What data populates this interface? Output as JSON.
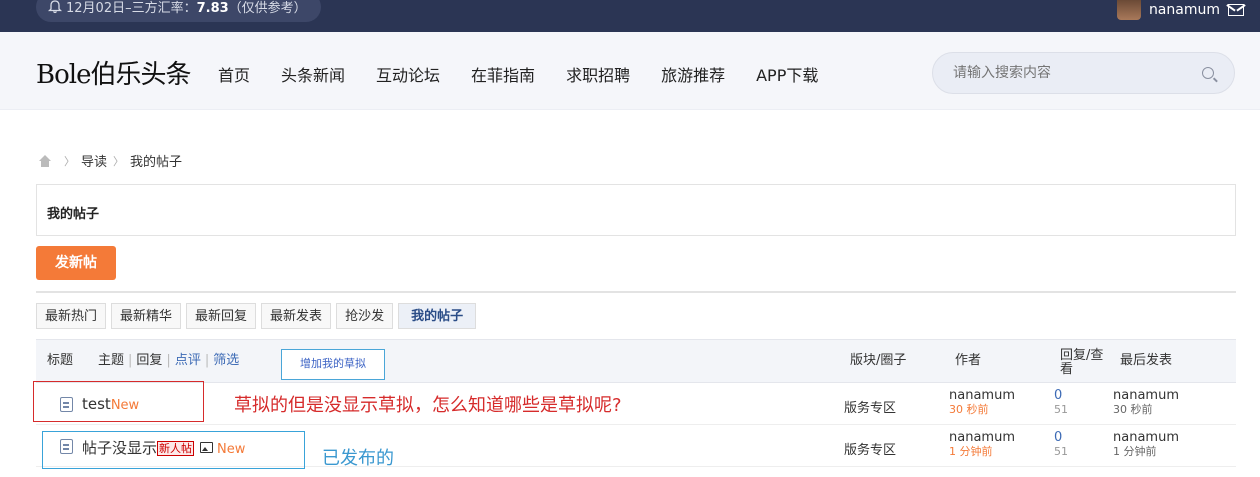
{
  "topbar": {
    "notice_prefix": "12月02日–三方汇率：",
    "notice_rate": "7.83",
    "notice_suffix": "（仅供参考）",
    "username": "nanamum"
  },
  "header": {
    "logo": "Bole伯乐头条",
    "nav": [
      "首页",
      "头条新闻",
      "互动论坛",
      "在菲指南",
      "求职招聘",
      "旅游推荐",
      "APP下载"
    ],
    "search_placeholder": "请输入搜索内容"
  },
  "breadcrumb": {
    "items": [
      "导读",
      "我的帖子"
    ]
  },
  "section": {
    "title": "我的帖子",
    "new_post": "发新帖"
  },
  "tabs": [
    "最新热门",
    "最新精华",
    "最新回复",
    "最新发表",
    "抢沙发",
    "我的帖子"
  ],
  "table_header": {
    "title": "标题",
    "filter_subject": "主题",
    "filter_reply": "回复",
    "filter_review": "点评",
    "filter_filter": "筛选",
    "add_draft": "增加我的草拟",
    "forum": "版块/圈子",
    "author": "作者",
    "replies_views": "回复/查看",
    "last_post": "最后发表"
  },
  "rows": [
    {
      "title": "test",
      "tag": "New",
      "forum": "版务专区",
      "author": "nanamum",
      "author_time": "30 秒前",
      "replies": "0",
      "views": "51",
      "last_user": "nanamum",
      "last_time": "30 秒前"
    },
    {
      "title": "帖子没显示",
      "badge": "新人帖",
      "tag": "New",
      "forum": "版务专区",
      "author": "nanamum",
      "author_time": "1 分钟前",
      "replies": "0",
      "views": "51",
      "last_user": "nanamum",
      "last_time": "1 分钟前"
    }
  ],
  "annotations": {
    "red_note": "草拟的但是没显示草拟，怎么知道哪些是草拟呢?",
    "blue_note": "已发布的"
  },
  "colors": {
    "accent": "#f47a38",
    "topbar": "#2b3554",
    "link": "#3c6ab5",
    "annotation_red": "#d62b2b",
    "annotation_blue": "#39a3d9"
  }
}
